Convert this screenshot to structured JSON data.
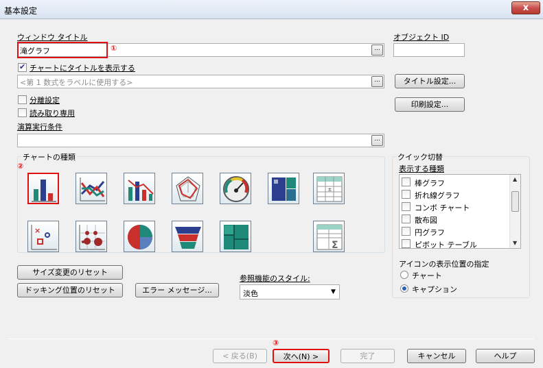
{
  "window": {
    "title": "基本設定",
    "close_glyph": "x"
  },
  "window_title_field": {
    "label": "ウィンドウ タイトル",
    "value": "滝グラフ",
    "marker": "①"
  },
  "object_id": {
    "label": "オブジェクト ID",
    "value": ""
  },
  "show_title": {
    "label": "チャートにタイトルを表示する",
    "checked": true,
    "placeholder": "<第 1 数式をラベルに使用する>"
  },
  "title_settings_button": "タイトル設定...",
  "print_settings_button": "印刷設定...",
  "detach": {
    "label": "分離設定",
    "checked": false
  },
  "readonly": {
    "label": "読み取り専用",
    "checked": false
  },
  "calc_condition": {
    "label": "演算実行条件",
    "value": ""
  },
  "browse_glyph": "...",
  "chart_types": {
    "label": "チャートの種類",
    "marker": "②",
    "icons": [
      "bar-chart-icon",
      "line-chart-icon",
      "combo-chart-icon",
      "radar-chart-icon",
      "gauge-chart-icon",
      "block-chart-icon",
      "pivot-table-icon",
      "scatter-chart-icon",
      "grid-chart-icon",
      "pie-chart-icon",
      "funnel-chart-icon",
      "mekko-chart-icon",
      "straight-table-icon"
    ]
  },
  "quick_change": {
    "label": "クイック切替",
    "list_label": "表示する種類",
    "items": [
      "棒グラフ",
      "折れ線グラフ",
      "コンボ チャート",
      "散布図",
      "円グラフ",
      "ピボット テーブル"
    ],
    "icon_position_label": "アイコンの表示位置の指定",
    "radio_chart": "チャート",
    "radio_caption": "キャプション",
    "selected": "キャプション"
  },
  "reset_size_button": "サイズ変更のリセット",
  "reset_docking_button": "ドッキング位置のリセット",
  "error_message_button": "エラー メッセージ...",
  "reference_style": {
    "label": "参照機能のスタイル:",
    "value": "淡色"
  },
  "footer": {
    "back": "< 戻る(B)",
    "next": "次へ(N) >",
    "finish": "完了",
    "cancel": "キャンセル",
    "help": "ヘルプ",
    "marker": "③"
  },
  "colors": {
    "accent_red": "#e01010",
    "teal": "#1f8a7a",
    "dark_blue": "#2c3f8f"
  }
}
